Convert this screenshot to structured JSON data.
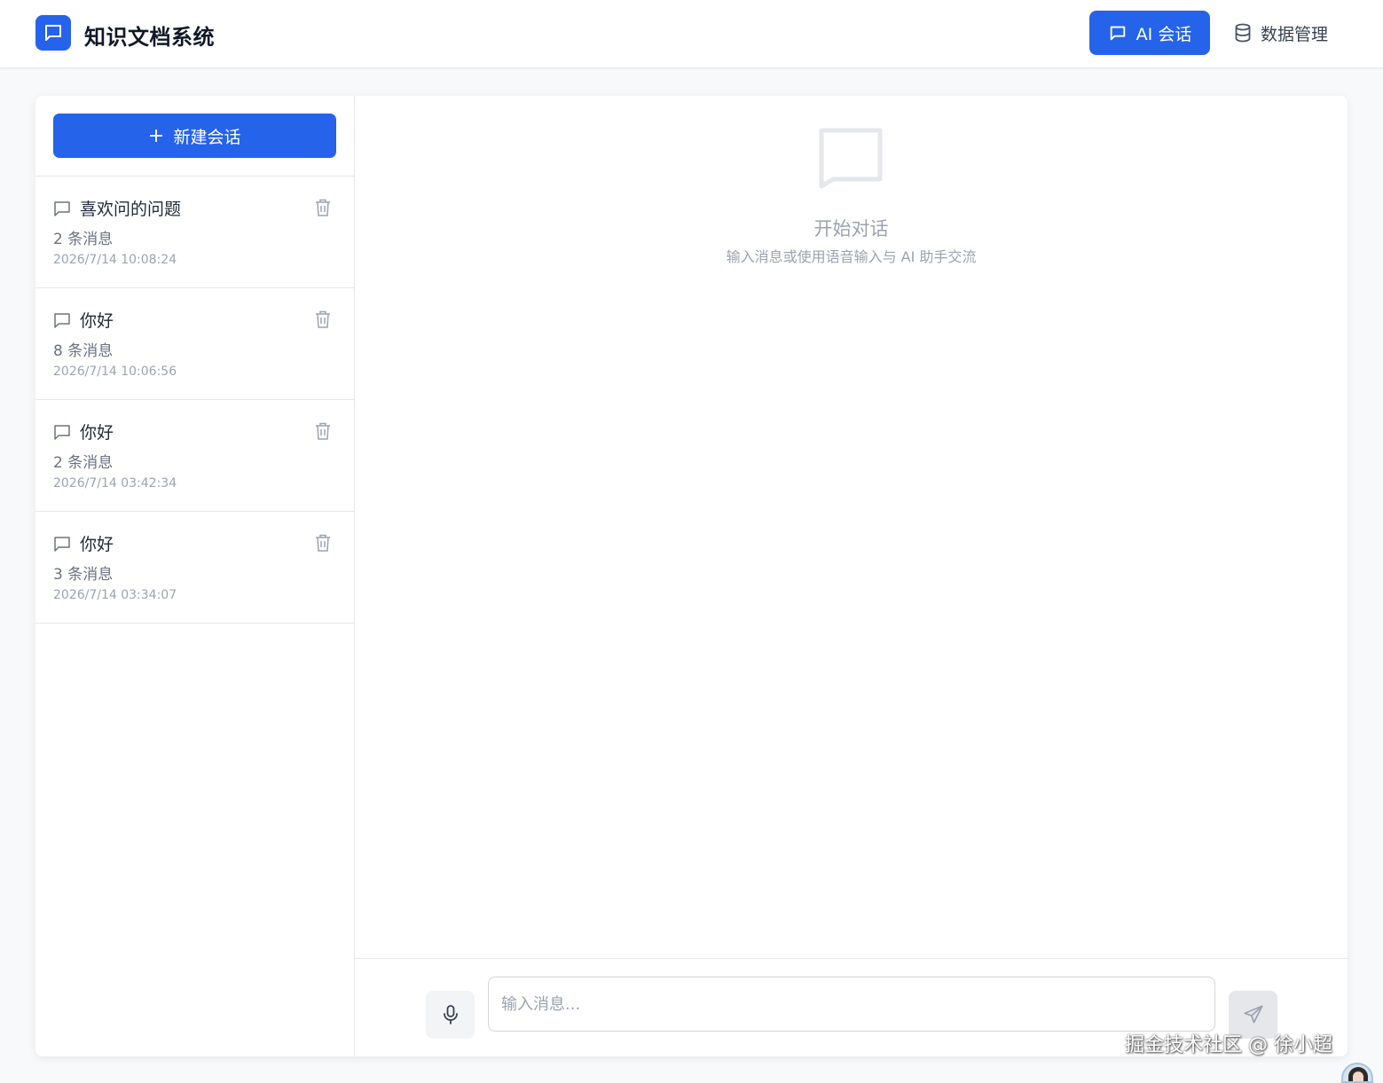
{
  "header": {
    "app_title": "知识文档系统",
    "nav": {
      "chat_label": "AI 会话",
      "data_label": "数据管理"
    }
  },
  "sidebar": {
    "new_session_label": "新建会话",
    "sessions": [
      {
        "title": "喜欢问的问题",
        "count": "2 条消息",
        "time": "2026/7/14 10:08:24"
      },
      {
        "title": "你好",
        "count": "8 条消息",
        "time": "2026/7/14 10:06:56"
      },
      {
        "title": "你好",
        "count": "2 条消息",
        "time": "2026/7/14 03:42:34"
      },
      {
        "title": "你好",
        "count": "3 条消息",
        "time": "2026/7/14 03:34:07"
      }
    ]
  },
  "main": {
    "empty_title": "开始对话",
    "empty_subtitle": "输入消息或使用语音输入与 AI 助手交流",
    "input": {
      "value": "",
      "placeholder": "输入消息..."
    }
  },
  "watermark": "掘金技术社区 @ 徐小超",
  "icons": {
    "logo": "chat-bubble-icon",
    "chat_nav": "chat-bubble-icon",
    "data_nav": "database-icon",
    "new": "plus-icon",
    "session": "chat-bubble-icon",
    "delete": "trash-icon",
    "empty": "chat-bubble-icon",
    "mic": "microphone-icon",
    "send": "send-icon"
  },
  "colors": {
    "primary": "#2563eb",
    "text_dark": "#111827",
    "muted": "#9ca3af",
    "border": "#e5e7eb"
  }
}
